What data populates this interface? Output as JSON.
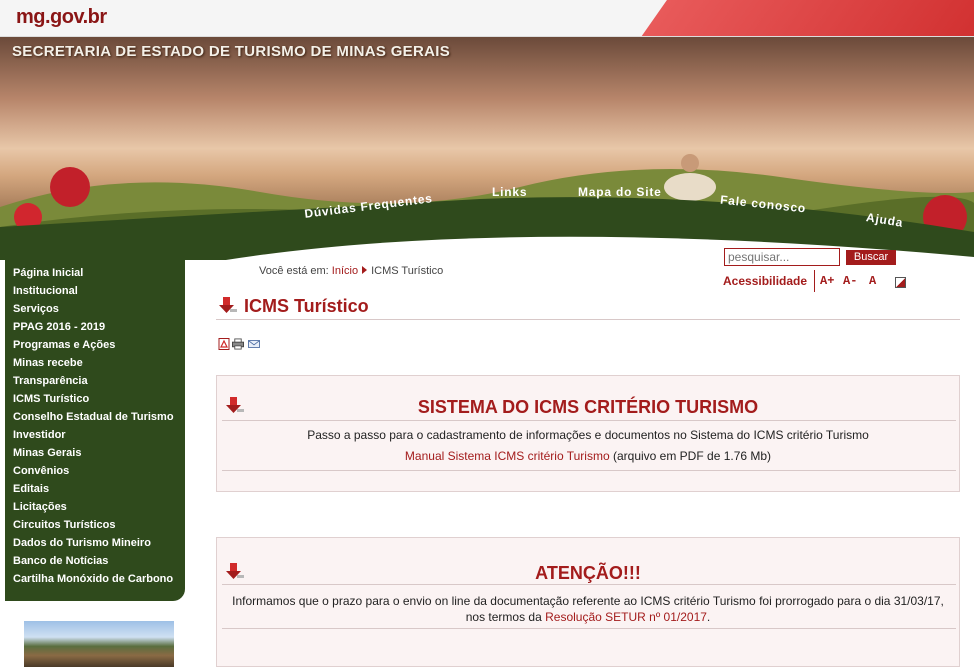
{
  "brand": {
    "logo": "mg.gov.br"
  },
  "banner": {
    "site_title": "SECRETARIA DE ESTADO DE TURISMO DE MINAS GERAIS",
    "nav": [
      "Dúvidas Frequentes",
      "Links",
      "Mapa do Site",
      "Fale conosco",
      "Ajuda"
    ]
  },
  "sidebar": {
    "items": [
      "Página Inicial",
      "Institucional",
      "Serviços",
      "PPAG 2016 - 2019",
      "Programas e Ações",
      "Minas recebe",
      "Transparência",
      "ICMS Turístico",
      "Conselho Estadual de Turismo",
      "Investidor",
      "Minas Gerais",
      "Convênios",
      "Editais",
      "Licitações",
      "Circuitos Turísticos",
      "Dados do Turismo Mineiro",
      "Banco de Notícias",
      "Cartilha Monóxido de Carbono"
    ]
  },
  "search": {
    "placeholder": "pesquisar...",
    "button": "Buscar"
  },
  "accessibility": {
    "label": "Acessibilidade",
    "increase": "A+",
    "decrease": "A-",
    "reset": "A"
  },
  "breadcrumb": {
    "prefix": "Você está em:",
    "home": "Início",
    "current": "ICMS Turístico"
  },
  "page": {
    "title": "ICMS Turístico"
  },
  "box1": {
    "title": "SISTEMA DO ICMS CRITÉRIO TURISMO",
    "text": "Passo a passo para o cadastramento de informações e documentos no Sistema do ICMS critério Turismo",
    "link": "Manual Sistema ICMS critério Turismo",
    "suffix": " (arquivo em PDF de 1.76 Mb)"
  },
  "box2": {
    "title": "ATENÇÃO!!!",
    "text": "Informamos que o prazo para o envio on line da documentação referente ao ICMS critério Turismo foi prorrogado para o dia 31/03/17, nos termos da ",
    "link": "Resolução SETUR nº 01/2017",
    "suffix": "."
  },
  "colors": {
    "accent": "#a31c1c",
    "sidebar": "#2f4a1c",
    "box_bg": "#fbf3f3"
  }
}
